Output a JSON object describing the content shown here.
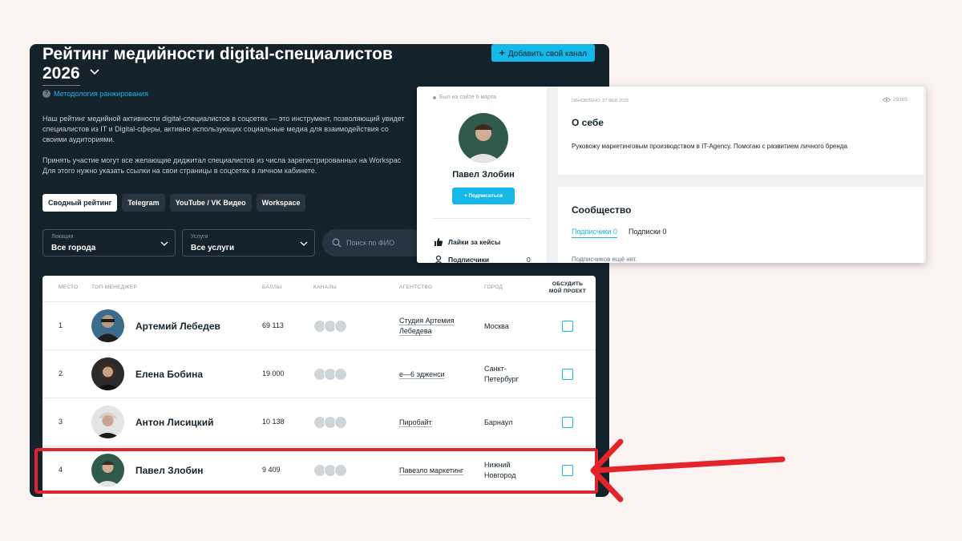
{
  "rating": {
    "title": "Рейтинг медийности digital-специалистов",
    "year": "2026",
    "add_channel_label": "Добавить свой канал",
    "methodology_label": "Методология ранжирования",
    "description": "Наш рейтинг медийной активности digital-специалистов в соцсетях — это инструмент, позволяющий увидет\nспециалистов из IT и Digital-сферы, активно использующих социальные медиа для взаимодействия со\nсвоими аудиториями.\n\nПринять участие могут все желающие диджитал специалистов из числа зарегистрированных на Workspac\nДля этого нужно указать ссылки на свои страницы в соцсетях в личном кабинете.",
    "tabs": [
      {
        "label": "Сводный рейтинг",
        "active": true
      },
      {
        "label": "Telegram",
        "active": false
      },
      {
        "label": "YouTube / VK Видео",
        "active": false
      },
      {
        "label": "Workspace",
        "active": false
      }
    ],
    "filters": {
      "location": {
        "label": "Локация",
        "value": "Все города"
      },
      "services": {
        "label": "Услуги",
        "value": "Все услуги"
      },
      "search_placeholder": "Поиск по ФИО"
    },
    "table": {
      "headers": {
        "place": "Место",
        "manager": "Топ-менеджер",
        "score": "Баллы",
        "channels": "Каналы",
        "agency": "Агентство",
        "city": "Город",
        "discuss": "Обсудить\nмой проект"
      },
      "rows": [
        {
          "place": "1",
          "name": "Артемий Лебедев",
          "score": "69 113",
          "agency": "Студия Артемия\nЛебедева",
          "city": "Москва"
        },
        {
          "place": "2",
          "name": "Елена Бобина",
          "score": "19 000",
          "agency": "е—6 эдженси",
          "city": "Санкт-\nПетербург"
        },
        {
          "place": "3",
          "name": "Антон Лисицкий",
          "score": "10 138",
          "agency": "Пиробайт",
          "city": "Барнаул"
        },
        {
          "place": "4",
          "name": "Павел Злобин",
          "score": "9 409",
          "agency": "Павезло маркетинг",
          "city": "Нижний\nНовгород"
        }
      ]
    }
  },
  "profile": {
    "last_seen": "Был на сайте 6 марта",
    "name": "Павел Злобин",
    "subscribe_label": "+ Подписаться",
    "stats": [
      {
        "label": "Лайки за кейсы",
        "count": "",
        "icon": "thumbs-up-icon"
      },
      {
        "label": "Подписчики",
        "count": "0",
        "icon": "user-icon"
      }
    ],
    "updated": "Обновлено: 27 фев 2025",
    "views": "29305",
    "about_title": "О себе",
    "about_text": "Руковожу маркетинговым производством в IT-Agency. Помогаю с развитием личного бренда",
    "community_title": "Сообщество",
    "community_tabs": [
      {
        "label": "Подписчики 0",
        "active": true
      },
      {
        "label": "Подписки 0",
        "active": false
      }
    ],
    "no_subscribers": "Подписчиков ещё нет."
  },
  "colors": {
    "panel_bg": "#14222c",
    "accent": "#16b8ea",
    "highlight": "#e3252b",
    "page_bg": "#fbf2f2"
  }
}
